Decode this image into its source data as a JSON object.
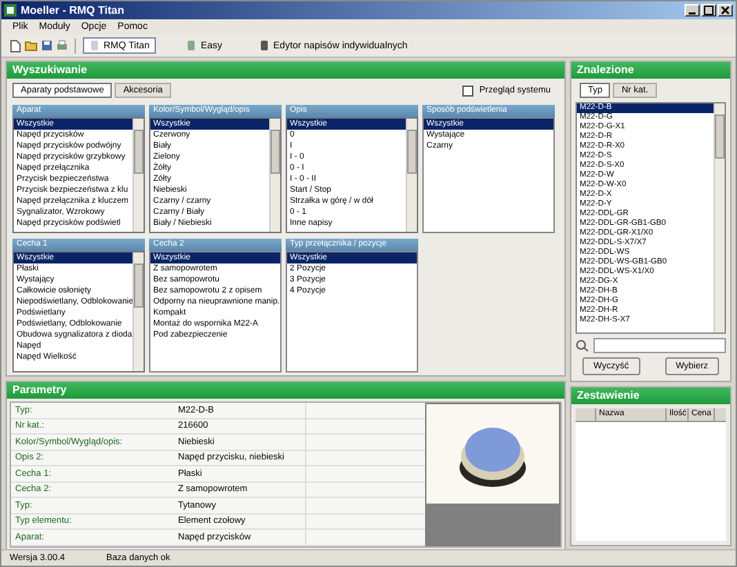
{
  "window": {
    "title": "Moeller - RMQ Titan"
  },
  "menu": [
    "Plik",
    "Moduły",
    "Opcje",
    "Pomoc"
  ],
  "toolbar": [
    {
      "label": "RMQ Titan",
      "selected": true
    },
    {
      "label": "Easy",
      "selected": false
    },
    {
      "label": "Edytor napisów indywidualnych",
      "selected": false
    }
  ],
  "search": {
    "title": "Wyszukiwanie",
    "tabs": [
      {
        "label": "Aparaty podstawowe",
        "selected": true
      },
      {
        "label": "Akcesoria",
        "selected": false
      }
    ],
    "overview": {
      "label": "Przegląd systemu",
      "checked": false
    },
    "rows": [
      [
        {
          "title": "Aparat",
          "scrollable": true,
          "items": [
            {
              "label": "Wszystkie",
              "selected": true
            },
            {
              "label": "Napęd przycisków",
              "selected": false
            },
            {
              "label": "Napęd przycisków podwójny",
              "selected": false
            },
            {
              "label": "Napęd przycisków grzybkowy",
              "selected": false
            },
            {
              "label": "Napęd przełącznika",
              "selected": false
            },
            {
              "label": "Przycisk bezpieczeństwa",
              "selected": false
            },
            {
              "label": "Przycisk bezpieczeństwa z klu",
              "selected": false
            },
            {
              "label": "Napęd przełącznika z kluczem",
              "selected": false
            },
            {
              "label": "Sygnalizator, Wzrokowy",
              "selected": false
            },
            {
              "label": "Napęd przycisków podświetl",
              "selected": false
            }
          ]
        },
        {
          "title": "Kolor/Symbol/Wygląd/opis",
          "scrollable": true,
          "items": [
            {
              "label": "Wszystkie",
              "selected": true
            },
            {
              "label": "Czerwony",
              "selected": false
            },
            {
              "label": "Biały",
              "selected": false
            },
            {
              "label": "Zielony",
              "selected": false
            },
            {
              "label": "Żółty",
              "selected": false
            },
            {
              "label": "Zółty",
              "selected": false
            },
            {
              "label": "Niebieski",
              "selected": false
            },
            {
              "label": "Czarny / czarny",
              "selected": false
            },
            {
              "label": "Czarny / Biały",
              "selected": false
            },
            {
              "label": "Biały / Niebieski",
              "selected": false
            }
          ]
        },
        {
          "title": "Opis",
          "scrollable": true,
          "items": [
            {
              "label": "Wszystkie",
              "selected": true
            },
            {
              "label": "0",
              "selected": false
            },
            {
              "label": "I",
              "selected": false
            },
            {
              "label": "I - 0",
              "selected": false
            },
            {
              "label": "0 - I",
              "selected": false
            },
            {
              "label": "I - 0 - II",
              "selected": false
            },
            {
              "label": "Start / Stop",
              "selected": false
            },
            {
              "label": "Strzałka w górę / w dół",
              "selected": false
            },
            {
              "label": "0 - 1",
              "selected": false
            },
            {
              "label": "Inne napisy",
              "selected": false
            }
          ]
        },
        {
          "title": "Sposób podświetlenia",
          "scrollable": false,
          "items": [
            {
              "label": "Wszystkie",
              "selected": true
            },
            {
              "label": "Wystające",
              "selected": false
            },
            {
              "label": "Czarny",
              "selected": false
            }
          ]
        }
      ],
      [
        {
          "title": "Cecha 1",
          "scrollable": true,
          "items": [
            {
              "label": "Wszystkie",
              "selected": true
            },
            {
              "label": "Płaski",
              "selected": false
            },
            {
              "label": "Wystający",
              "selected": false
            },
            {
              "label": "Całkowicie osłonięty",
              "selected": false
            },
            {
              "label": "Niepodświetlany, Odblokowanie",
              "selected": false
            },
            {
              "label": "Podświetlany",
              "selected": false
            },
            {
              "label": "Podświetlany, Odblokowanie",
              "selected": false
            },
            {
              "label": "Obudowa sygnalizatora z dioda",
              "selected": false
            },
            {
              "label": "Napęd",
              "selected": false
            },
            {
              "label": "Napęd Wielkość",
              "selected": false
            }
          ]
        },
        {
          "title": "Cecha 2",
          "scrollable": false,
          "items": [
            {
              "label": "Wszystkie",
              "selected": true
            },
            {
              "label": "Z samopowrotem",
              "selected": false
            },
            {
              "label": "Bez samopowrotu",
              "selected": false
            },
            {
              "label": "Bez samopowrotu 2 z opisem",
              "selected": false
            },
            {
              "label": "Odporny na nieuprawnione manip.",
              "selected": false
            },
            {
              "label": "Kompakt",
              "selected": false
            },
            {
              "label": "Montaż do wspornika M22-A",
              "selected": false
            },
            {
              "label": "Pod zabezpieczenie",
              "selected": false
            }
          ]
        },
        {
          "title": "Typ przełącznika / pozycje",
          "scrollable": false,
          "items": [
            {
              "label": "Wszystkie",
              "selected": true
            },
            {
              "label": "2 Pozycje",
              "selected": false
            },
            {
              "label": "3 Pozycje",
              "selected": false
            },
            {
              "label": "4 Pozycje",
              "selected": false
            }
          ]
        }
      ]
    ]
  },
  "found": {
    "title": "Znalezione",
    "tabs": [
      {
        "label": "Typ",
        "selected": true
      },
      {
        "label": "Nr kat.",
        "selected": false
      }
    ],
    "items": [
      {
        "label": "M22-D-B",
        "selected": true
      },
      {
        "label": "M22-D-G",
        "selected": false
      },
      {
        "label": "M22-D-G-X1",
        "selected": false
      },
      {
        "label": "M22-D-R",
        "selected": false
      },
      {
        "label": "M22-D-R-X0",
        "selected": false
      },
      {
        "label": "M22-D-S",
        "selected": false
      },
      {
        "label": "M22-D-S-X0",
        "selected": false
      },
      {
        "label": "M22-D-W",
        "selected": false
      },
      {
        "label": "M22-D-W-X0",
        "selected": false
      },
      {
        "label": "M22-D-X",
        "selected": false
      },
      {
        "label": "M22-D-Y",
        "selected": false
      },
      {
        "label": "M22-DDL-GR",
        "selected": false
      },
      {
        "label": "M22-DDL-GR-GB1-GB0",
        "selected": false
      },
      {
        "label": "M22-DDL-GR-X1/X0",
        "selected": false
      },
      {
        "label": "M22-DDL-S-X7/X7",
        "selected": false
      },
      {
        "label": "M22-DDL-WS",
        "selected": false
      },
      {
        "label": "M22-DDL-WS-GB1-GB0",
        "selected": false
      },
      {
        "label": "M22-DDL-WS-X1/X0",
        "selected": false
      },
      {
        "label": "M22-DG-X",
        "selected": false
      },
      {
        "label": "M22-DH-B",
        "selected": false
      },
      {
        "label": "M22-DH-G",
        "selected": false
      },
      {
        "label": "M22-DH-R",
        "selected": false
      },
      {
        "label": "M22-DH-S-X7",
        "selected": false
      }
    ],
    "buttons": [
      "Wyczyść",
      "Wybierz"
    ]
  },
  "parameters": {
    "title": "Parametry",
    "rows": [
      {
        "name": "Typ:",
        "value": "M22-D-B"
      },
      {
        "name": "Nr kat.:",
        "value": "216600"
      },
      {
        "name": "Kolor/Symbol/Wygląd/opis:",
        "value": "Niebieski"
      },
      {
        "name": "Opis 2:",
        "value": "Napęd przycisku, niebieski"
      },
      {
        "name": "Cecha 1:",
        "value": "Płaski"
      },
      {
        "name": "Cecha 2:",
        "value": "Z samopowrotem"
      },
      {
        "name": "Typ:",
        "value": "Tytanowy"
      },
      {
        "name": "Typ elementu:",
        "value": "Element czołowy"
      },
      {
        "name": "Aparat:",
        "value": "Napęd przycisków"
      }
    ]
  },
  "summary": {
    "title": "Zestawienie",
    "columns": [
      "Nazwa",
      "Ilość",
      "Cena"
    ]
  },
  "status_bar": [
    "Wersja 3.00.4",
    "Baza danych ok"
  ]
}
